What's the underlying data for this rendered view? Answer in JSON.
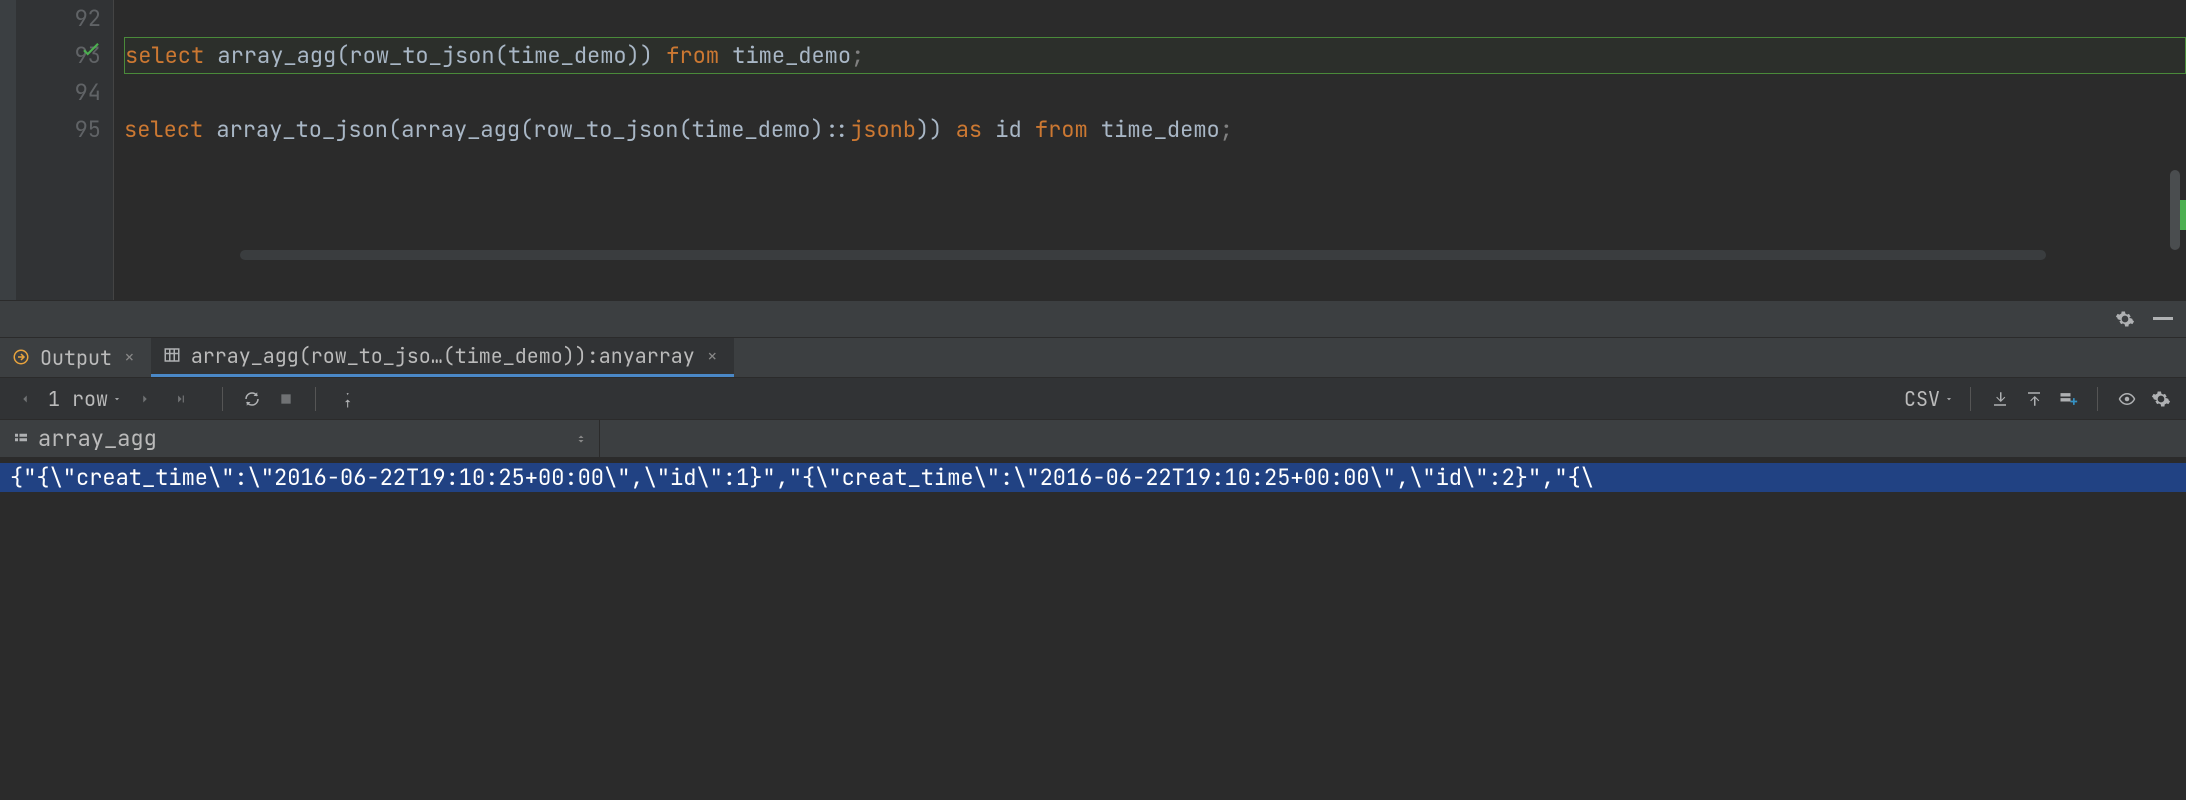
{
  "editor": {
    "lines": [
      {
        "num": "92",
        "tokens": []
      },
      {
        "num": "93",
        "tokens": [
          {
            "t": "select ",
            "c": "kw"
          },
          {
            "t": "array_agg",
            "c": "fn"
          },
          {
            "t": "(",
            "c": "punct"
          },
          {
            "t": "row_to_json",
            "c": "fn"
          },
          {
            "t": "(",
            "c": "punct"
          },
          {
            "t": "time_demo",
            "c": "ident"
          },
          {
            "t": ")) ",
            "c": "punct"
          },
          {
            "t": "from ",
            "c": "kw"
          },
          {
            "t": "time_demo",
            "c": "ident"
          },
          {
            "t": ";",
            "c": "semi"
          }
        ],
        "highlighted": true,
        "checked": true
      },
      {
        "num": "94",
        "tokens": []
      },
      {
        "num": "95",
        "tokens": [
          {
            "t": "select ",
            "c": "kw"
          },
          {
            "t": "array_to_json",
            "c": "fn"
          },
          {
            "t": "(",
            "c": "punct"
          },
          {
            "t": "array_agg",
            "c": "fn"
          },
          {
            "t": "(",
            "c": "punct"
          },
          {
            "t": "row_to_json",
            "c": "fn"
          },
          {
            "t": "(",
            "c": "punct"
          },
          {
            "t": "time_demo",
            "c": "ident"
          },
          {
            "t": ")::",
            "c": "punct"
          },
          {
            "t": "jsonb",
            "c": "type"
          },
          {
            "t": ")) ",
            "c": "punct"
          },
          {
            "t": "as ",
            "c": "kw"
          },
          {
            "t": "id ",
            "c": "ident"
          },
          {
            "t": "from ",
            "c": "kw"
          },
          {
            "t": "time_demo",
            "c": "ident"
          },
          {
            "t": ";",
            "c": "semi"
          }
        ]
      }
    ]
  },
  "tabs": {
    "output_label": "Output",
    "result_label": "array_agg(row_to_jso…(time_demo)):anyarray"
  },
  "toolbar": {
    "row_count": "1 row",
    "format": "CSV"
  },
  "result": {
    "column_header": "array_agg",
    "cell_value": "{\"{\\\"creat_time\\\":\\\"2016-06-22T19:10:25+00:00\\\",\\\"id\\\":1}\",\"{\\\"creat_time\\\":\\\"2016-06-22T19:10:25+00:00\\\",\\\"id\\\":2}\",\"{\\"
  },
  "icons": {
    "check": "check-icon",
    "gear": "gear-icon",
    "minimize": "minimize-icon",
    "output": "output-icon",
    "table": "table-icon",
    "close": "close-icon",
    "prev": "prev-icon",
    "next": "next-icon",
    "last": "last-icon",
    "reload": "reload-icon",
    "stop": "stop-icon",
    "pin": "pin-icon",
    "download": "download-icon",
    "upload": "upload-icon",
    "add": "add-icon",
    "eye": "eye-icon"
  }
}
